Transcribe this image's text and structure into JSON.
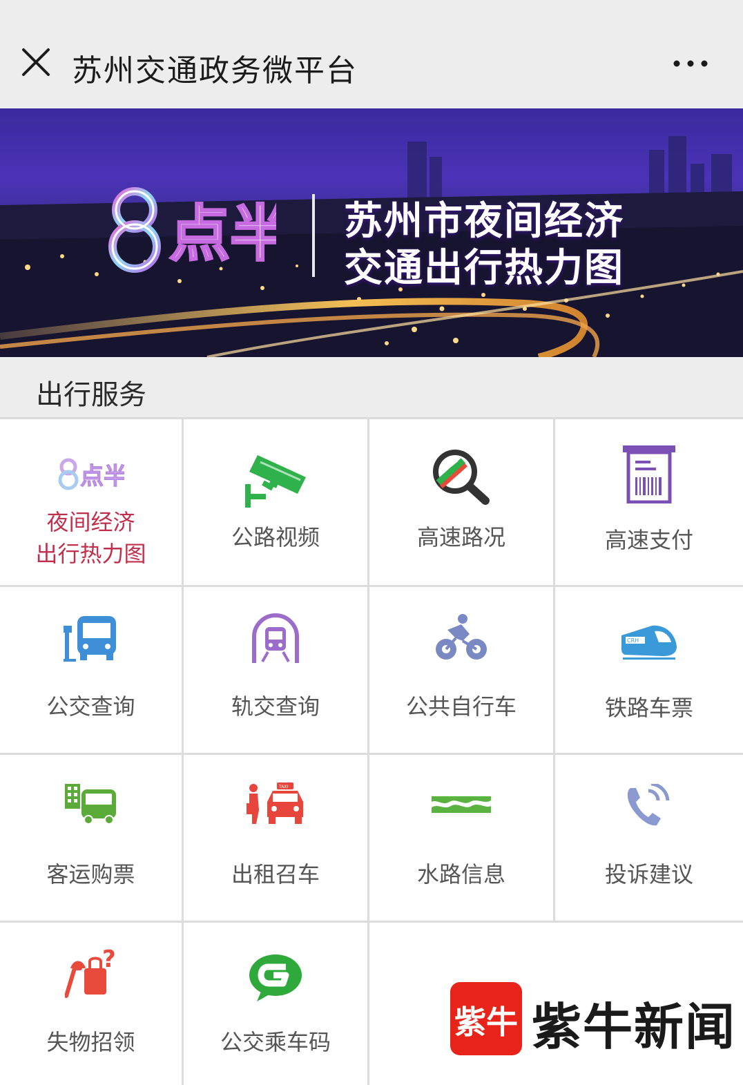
{
  "header": {
    "title": "苏州交通政务微平台"
  },
  "banner": {
    "logo_text": "8点半",
    "title_line1": "苏州市夜间经济",
    "title_line2": "交通出行热力图"
  },
  "section": {
    "title": "出行服务"
  },
  "services": [
    {
      "line1": "夜间经济",
      "line2": "出行热力图",
      "icon": "night-economy-logo-icon"
    },
    {
      "label": "公路视频",
      "icon": "camera-icon",
      "color": "#2fb24c"
    },
    {
      "label": "高速路况",
      "icon": "magnifier-road-icon"
    },
    {
      "label": "高速支付",
      "icon": "toll-receipt-icon",
      "color": "#7b4fb3"
    },
    {
      "label": "公交查询",
      "icon": "bus-icon",
      "color": "#3f8ed8"
    },
    {
      "label": "轨交查询",
      "icon": "metro-icon",
      "color": "#9b6cc9"
    },
    {
      "label": "公共自行车",
      "icon": "bicycle-icon",
      "color": "#7a88c4"
    },
    {
      "label": "铁路车票",
      "icon": "high-speed-train-icon",
      "color": "#3a9ad9"
    },
    {
      "label": "客运购票",
      "icon": "coach-icon",
      "color": "#5aab3a"
    },
    {
      "label": "出租召车",
      "icon": "taxi-icon",
      "color": "#e8453c"
    },
    {
      "label": "水路信息",
      "icon": "waves-icon",
      "color": "#5ab340"
    },
    {
      "label": "投诉建议",
      "icon": "phone-icon",
      "color": "#8a9ad0"
    },
    {
      "label": "失物招领",
      "icon": "lost-found-icon",
      "color": "#e84a3c"
    },
    {
      "label": "公交乘车码",
      "icon": "bus-code-icon",
      "color": "#2fa83c"
    }
  ],
  "watermark": {
    "badge_text": "紫牛",
    "text": "紫牛新闻"
  }
}
